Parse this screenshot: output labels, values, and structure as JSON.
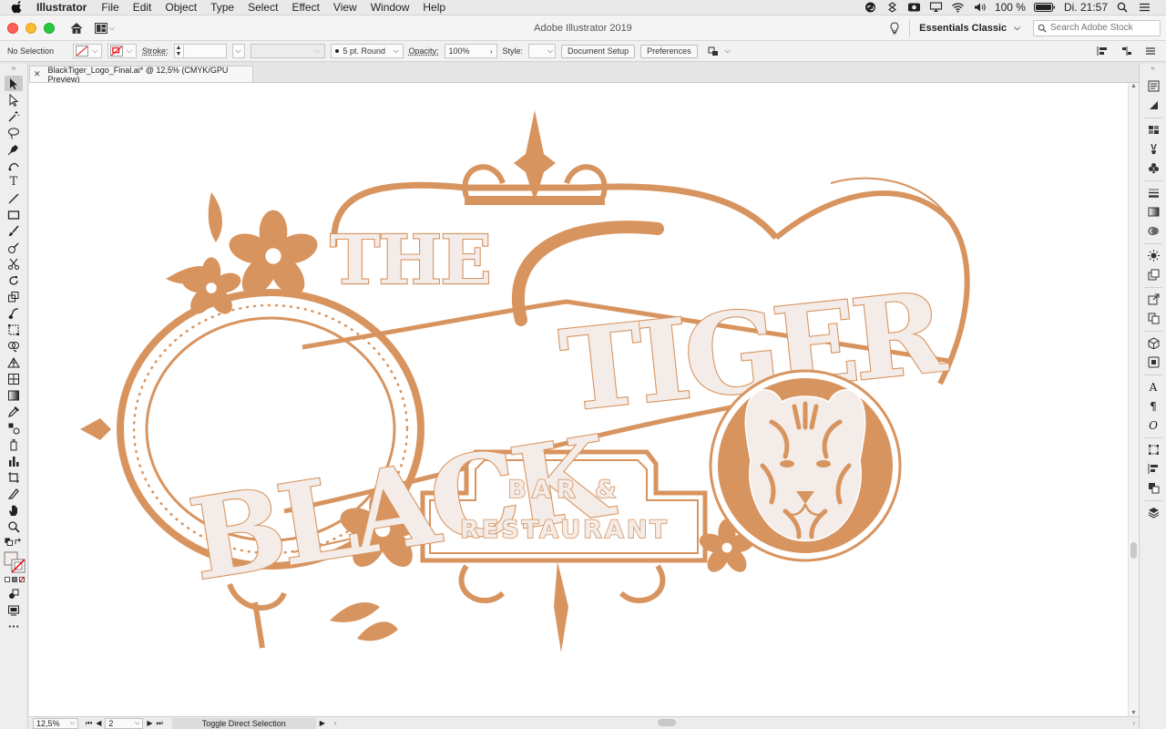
{
  "menubar": {
    "app_name": "Illustrator",
    "items": [
      "File",
      "Edit",
      "Object",
      "Type",
      "Select",
      "Effect",
      "View",
      "Window",
      "Help"
    ],
    "battery": "100 %",
    "clock": "Di. 21:57"
  },
  "titlebar": {
    "title": "Adobe Illustrator 2019",
    "workspace": "Essentials Classic",
    "search_placeholder": "Search Adobe Stock"
  },
  "controlbar": {
    "selection": "No Selection",
    "stroke_label": "Stroke:",
    "brush": "5 pt. Round",
    "opacity_label": "Opacity:",
    "opacity_value": "100%",
    "style_label": "Style:",
    "document_setup": "Document Setup",
    "preferences": "Preferences"
  },
  "document": {
    "tab_title": "BlackTiger_Logo_Final.ai* @ 12,5% (CMYK/GPU Preview)"
  },
  "artwork": {
    "accent": "#d8945f",
    "cream": "#f3ece8",
    "line_the": "THE",
    "line_black": "BLACK",
    "line_tiger": "TIGER",
    "line_bar": "BAR &",
    "line_restaurant": "RESTAURANT"
  },
  "statusbar": {
    "zoom": "12,5%",
    "artboard": "2",
    "status": "Toggle Direct Selection"
  }
}
